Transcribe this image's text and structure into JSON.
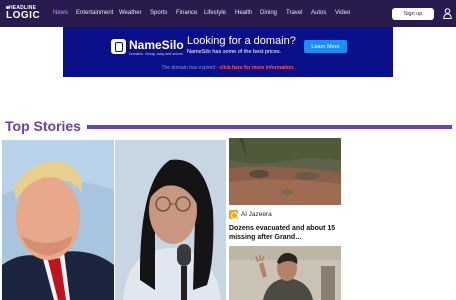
{
  "nav": {
    "logo_top": "HEADLINE",
    "logo_bottom": "LOGIC",
    "links": [
      "News",
      "Entertainment",
      "Weather",
      "Sports",
      "Finance",
      "Lifestyle",
      "Health",
      "Dining",
      "Travel",
      "Autos",
      "Video"
    ],
    "active_link": "News",
    "signup_label": "Sign up"
  },
  "ad": {
    "brand": "NameSilo",
    "tagline": "Domains. Cheap, easy and secure.",
    "headline": "Looking for a domain?",
    "subtext": "NameSilo has some of the best prices.",
    "button_label": "Learn More",
    "footer_text": "The domain has expired - ",
    "footer_link": "click here for more information."
  },
  "top_stories": {
    "title": "Top Stories",
    "cards": [
      {
        "image": "trump-portrait"
      },
      {
        "image": "woman-at-microphone"
      },
      {
        "image": "flood-debris",
        "source": "Al Jazeera",
        "headline": "Dozens evacuated and about 15 missing after Grand…"
      },
      {
        "image": "man-gesturing"
      }
    ]
  },
  "colors": {
    "nav_bg": "#2a1b4f",
    "accent": "#6b3fb8",
    "active_link": "#b69cff",
    "ad_bg": "#0c0f8a",
    "ad_button": "#1c8ef5",
    "ad_link": "#ff5555",
    "source_icon": "#f4a51c"
  }
}
